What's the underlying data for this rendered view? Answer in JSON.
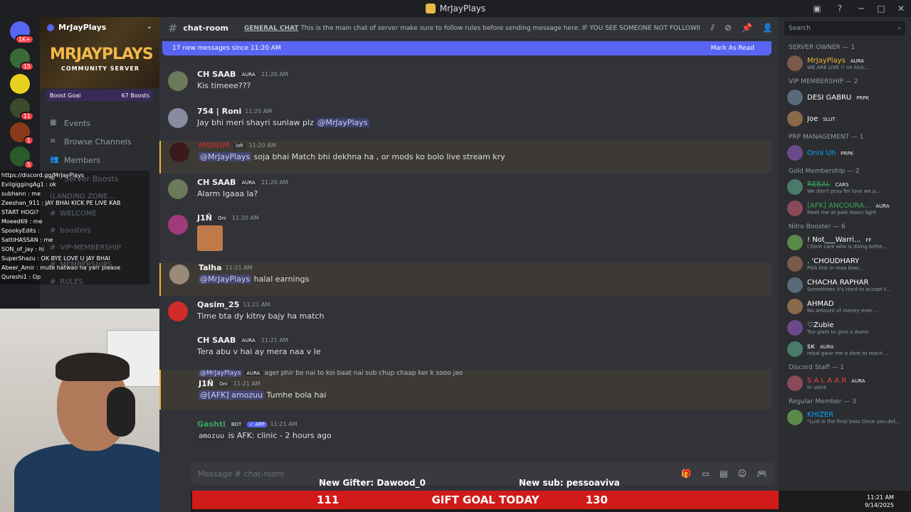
{
  "window": {
    "title": "MrJayPlays"
  },
  "guild_badges": [
    "1K+",
    "15",
    "11",
    "1",
    "5"
  ],
  "server": {
    "name": "MrJayPlays",
    "banner_title": "MRJAYPLAYS",
    "banner_sub": "COMMUNITY SERVER",
    "boost_label": "Boost Goal",
    "boost_count": "67 Boosts",
    "nav": [
      "Events",
      "Browse Channels",
      "Members",
      "Server Boosts"
    ],
    "channels": [
      "(LANDING ZONE...",
      "WELCOME",
      "boosters",
      "VIP-MEMBERSHIP",
      "MEMBERSHIPS",
      "RULES"
    ]
  },
  "overlay_chat": [
    "https://discord.gg/MrJayPlays",
    "EvilgiggingAg1 : ok",
    "subhann : me",
    "Zeeshan_911 : JAY BHAI KICK PE LIVE KAB",
    "START HOGI?",
    "Moeed69 : me",
    "SpookyEdits : ",
    "SattiHASSAN : me",
    "SON_of_jay : hi",
    "SuperShazu : OK BYE LOVE U JAY BHAI",
    "Abeer_Amir : mute hatwao na yarr please",
    "Qureshi1 : Op"
  ],
  "channel": {
    "name": "chat-room",
    "topic_bold": "GENERAL CHAT",
    "topic": "This is the main chat of server make sure to follow rules before sending message here. IF YOU SEE SOMEONE NOT FOLLOWING T...",
    "new_messages": "17 new messages since 11:20 AM",
    "mark_read": "Mark As Read",
    "input_placeholder": "Message # chat-room"
  },
  "messages": [
    {
      "name": "CH SAAB",
      "tag": "AURA",
      "time": "11:20 AM",
      "text": "Kis timeee???"
    },
    {
      "name": "754 | Roni",
      "time": "11:20 AM",
      "text": "Jay bhi meri shayri sunlaw plz ",
      "mention": "@MrJayPlays"
    },
    {
      "name": "MUNIM",
      "tag": "lofi",
      "time": "11:20 AM",
      "mention": "@MrJayPlays",
      "text": " soja bhai Match bhi dekhna ha , or mods ko bolo live stream kry"
    },
    {
      "name": "CH SAAB",
      "tag": "AURA",
      "time": "11:20 AM",
      "text": "Alarm lgaaa la?"
    },
    {
      "name": "J1Ň",
      "tag": "Oni",
      "time": "11:20 AM",
      "text": ""
    },
    {
      "name": "Talha",
      "time": "11:21 AM",
      "mention": "@MrJayPlays",
      "text": " halal earnings"
    },
    {
      "name": "Qasim_25",
      "time": "11:21 AM",
      "text": "Time bta dy kitny bajy ha match"
    },
    {
      "name": "CH SAAB",
      "tag": "AURA",
      "time": "11:21 AM",
      "text": "Tera abu v hai ay mera naa v le"
    },
    {
      "reply": "@MrJayPlays",
      "reply_tag": "AURA",
      "reply_text": "ager phir be nai to koi baat nai sub chup chaap ker k sooo jao",
      "name": "J1Ň",
      "tag": "Oni",
      "time": "11:21 AM",
      "mention": "@[AFK] amozuu",
      "text": " Tumhe bola hai"
    },
    {
      "name": "Gashti",
      "bot": "BOT",
      "app": "✓ APP",
      "time": "11:21 AM",
      "code": "amozuu",
      "text": " is AFK: clinic - 2 hours ago"
    }
  ],
  "ticker": {
    "gifter": "New Gifter: Dawood_0",
    "sub": "New sub: pessoaviva",
    "left": "111",
    "mid": "GIFT GOAL TODAY",
    "right": "130"
  },
  "members": {
    "search": "Search",
    "groups": [
      {
        "title": "SERVER OWNER — 1",
        "items": [
          {
            "name": "MrJayPlays",
            "tag": "AURA",
            "status": "WE ARE LIVE !! on kick...",
            "color": "#f0b232"
          }
        ]
      },
      {
        "title": "VIP MEMBERSHIP — 2",
        "items": [
          {
            "name": "DESI GABRU",
            "tag": "PRPK",
            "status": "",
            "color": "#ffffff"
          },
          {
            "name": "Joe",
            "tag": "SLUT",
            "status": "",
            "color": "#ffffff"
          }
        ]
      },
      {
        "title": "PRP MANAGEMENT — 1",
        "items": [
          {
            "name": "Onni Uh",
            "tag": "PRPK",
            "status": "",
            "color": "#00a8fc"
          }
        ]
      },
      {
        "title": "Gold Membership — 2",
        "items": [
          {
            "name": "R̶E̶B̶A̶L̶",
            "tag": "CARS",
            "status": "We don't pray for love we p...",
            "color": "#3ba55c"
          },
          {
            "name": "[AFK] ANCOURA...",
            "tag": "AURA",
            "status": "Meet me at pale moon light",
            "color": "#3ba55c"
          }
        ]
      },
      {
        "title": "Nitro Booster — 6",
        "items": [
          {
            "name": "! Not___Warri...",
            "tag": "FF",
            "status": "I Dont care who is doing bette...",
            "color": "#ffffff"
          },
          {
            "name": ". 'CHOUDHARY",
            "tag": "",
            "status": "PGA link in maa bioo...",
            "color": "#ffffff"
          },
          {
            "name": "CHACHA RAPHAR",
            "tag": "",
            "status": "Sometimes it's Hard to accept t...",
            "color": "#ffffff"
          },
          {
            "name": "AHMAD",
            "tag": "",
            "status": "No amount of money ever ...",
            "color": "#ffffff"
          },
          {
            "name": "♡Zubie",
            "tag": "",
            "status": "Too glam to give a damn",
            "color": "#ffffff"
          },
          {
            "name": "ꜱᴋ",
            "tag": "AURA",
            "status": "rebal gave me a dare to reach ...",
            "color": "#ffffff"
          }
        ]
      },
      {
        "title": "Discord Staff — 1",
        "items": [
          {
            "name": "S A L A A R",
            "tag": "AURA",
            "status": "In voice",
            "color": "#f23f43"
          }
        ]
      },
      {
        "title": "Regular Member — 3",
        "items": [
          {
            "name": "KHIZER",
            "tag": "",
            "status": "\"Lust is the final boss Once you def...",
            "color": "#00a8fc"
          }
        ]
      }
    ]
  },
  "clock": {
    "time": "11:21 AM",
    "date": "9/14/2025"
  }
}
